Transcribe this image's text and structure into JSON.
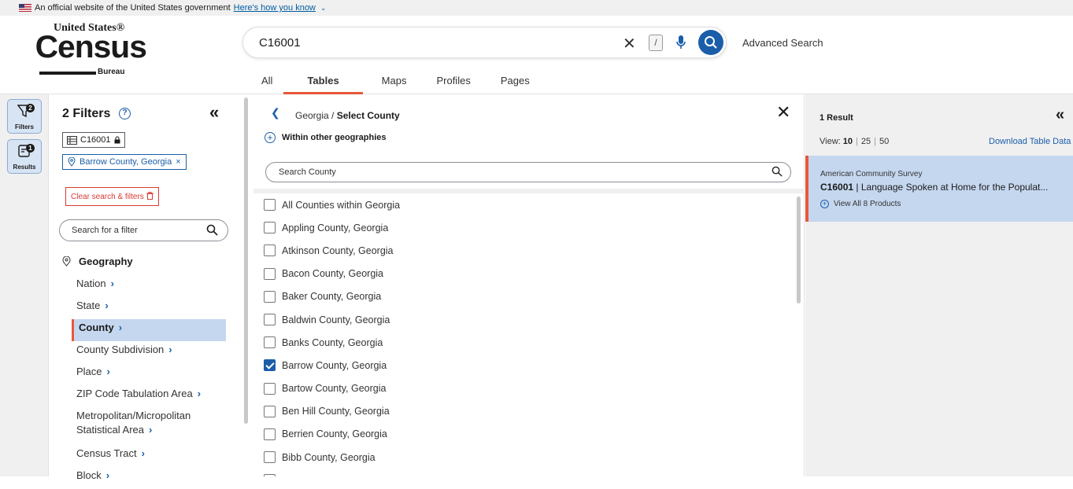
{
  "gov_banner": {
    "text": "An official website of the United States government",
    "link": "Here's how you know"
  },
  "logo": {
    "line1": "United States®",
    "line2": "Census",
    "line3": "Bureau"
  },
  "search": {
    "value": "C16001",
    "slash": "/",
    "advanced": "Advanced Search"
  },
  "tabs": [
    {
      "label": "All"
    },
    {
      "label": "Tables",
      "active": true
    },
    {
      "label": "Maps"
    },
    {
      "label": "Profiles"
    },
    {
      "label": "Pages"
    }
  ],
  "rail": {
    "filters_label": "Filters",
    "filters_count": "2",
    "results_label": "Results",
    "results_count": "1"
  },
  "filters_panel": {
    "title": "2 Filters",
    "help": "?",
    "chip_table": "C16001",
    "chip_geo": "Barrow County, Georgia",
    "clear": "Clear search & filters",
    "search_placeholder": "Search for a filter",
    "geography_heading": "Geography",
    "geography_items": [
      "Nation",
      "State",
      "County",
      "County Subdivision",
      "Place",
      "ZIP Code Tabulation Area",
      "Metropolitan/Micropolitan Statistical Area",
      "Census Tract",
      "Block"
    ],
    "selected_item": "County"
  },
  "county_panel": {
    "crumb_state": "Georgia / ",
    "crumb_current": "Select County",
    "within": "Within other geographies",
    "search_placeholder": "Search County",
    "items": [
      {
        "label": "All Counties within Georgia",
        "checked": false
      },
      {
        "label": "Appling County, Georgia",
        "checked": false
      },
      {
        "label": "Atkinson County, Georgia",
        "checked": false
      },
      {
        "label": "Bacon County, Georgia",
        "checked": false
      },
      {
        "label": "Baker County, Georgia",
        "checked": false
      },
      {
        "label": "Baldwin County, Georgia",
        "checked": false
      },
      {
        "label": "Banks County, Georgia",
        "checked": false
      },
      {
        "label": "Barrow County, Georgia",
        "checked": true
      },
      {
        "label": "Bartow County, Georgia",
        "checked": false
      },
      {
        "label": "Ben Hill County, Georgia",
        "checked": false
      },
      {
        "label": "Berrien County, Georgia",
        "checked": false
      },
      {
        "label": "Bibb County, Georgia",
        "checked": false
      },
      {
        "label": "",
        "checked": false
      }
    ]
  },
  "results_panel": {
    "count": "1 Result",
    "view_label": "View:",
    "view_options": [
      "10",
      "25",
      "50"
    ],
    "download": "Download Table Data",
    "card": {
      "source": "American Community Survey",
      "table_id": "C16001",
      "separator": " | ",
      "title": "Language Spoken at Home for the Populat...",
      "more": "View All 8 Products"
    }
  }
}
